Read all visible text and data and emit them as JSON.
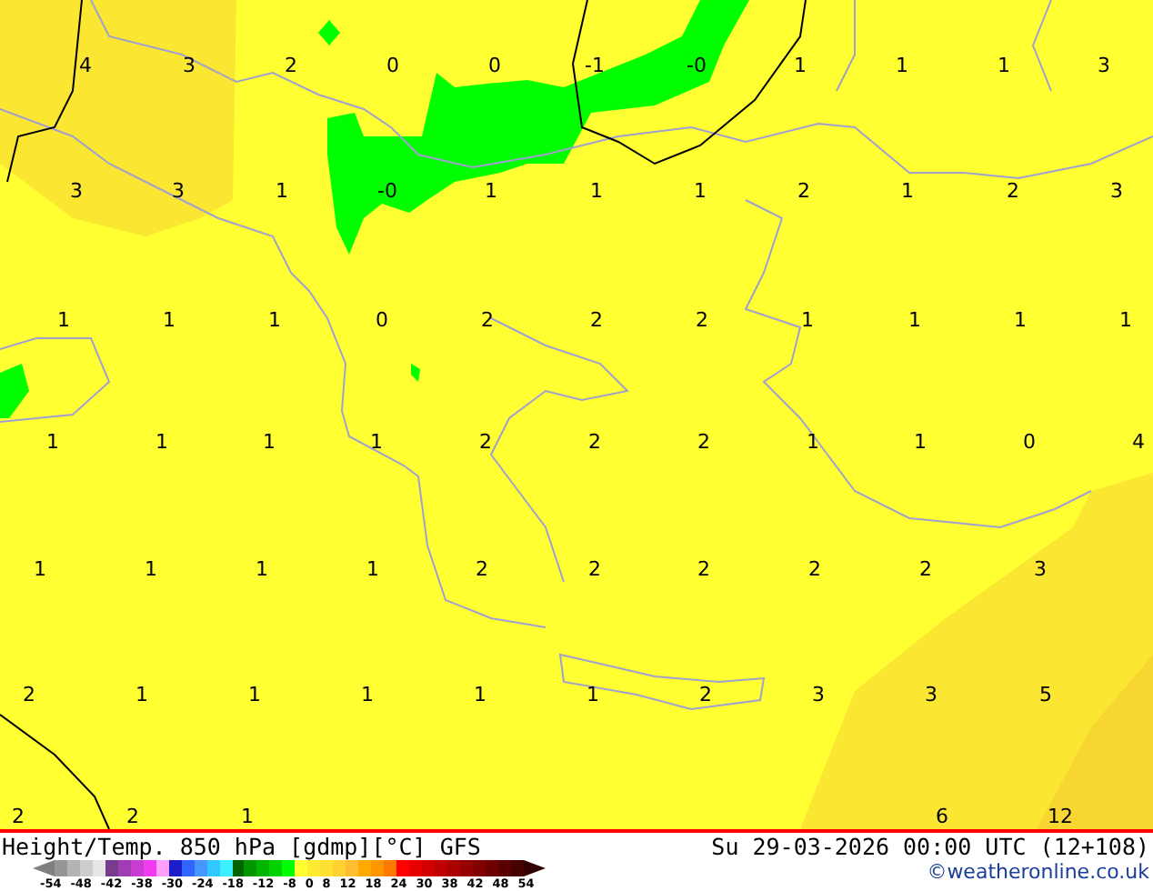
{
  "map": {
    "value_rows": [
      [
        "4",
        "3",
        "2",
        "0",
        "0",
        "-1",
        "-0",
        "1",
        "1",
        "1",
        "3"
      ],
      [
        "3",
        "3",
        "1",
        "-0",
        "1",
        "1",
        "1",
        "2",
        "1",
        "2",
        "3"
      ],
      [
        "1",
        "1",
        "1",
        "0",
        "2",
        "2",
        "2",
        "1",
        "1",
        "1",
        "1"
      ],
      [
        "1",
        "1",
        "1",
        "1",
        "2",
        "2",
        "2",
        "1",
        "1",
        "0",
        "4"
      ],
      [
        "1",
        "1",
        "1",
        "1",
        "2",
        "2",
        "2",
        "2",
        "2",
        "3"
      ],
      [
        "2",
        "1",
        "1",
        "1",
        "1",
        "1",
        "2",
        "3",
        "3",
        "5"
      ],
      [
        "2",
        "2",
        "1",
        "6",
        "12"
      ]
    ]
  },
  "footer": {
    "title": "Height/Temp. 850 hPa [gdmp][°C] GFS",
    "valid_time": "Su 29-03-2026 00:00 UTC (12+108)",
    "legend": {
      "colors": [
        {
          "color": "#969696"
        },
        {
          "color": "#b4b4b4"
        },
        {
          "color": "#cdcdcd"
        },
        {
          "color": "#e6e6e6"
        },
        {
          "color": "#783c8c"
        },
        {
          "color": "#a03cb4"
        },
        {
          "color": "#c83cd2"
        },
        {
          "color": "#f03cf0"
        },
        {
          "color": "#ffa0ff"
        },
        {
          "color": "#1e1ec8"
        },
        {
          "color": "#3264ff"
        },
        {
          "color": "#4696ff"
        },
        {
          "color": "#32c8ff"
        },
        {
          "color": "#3cf0ff"
        },
        {
          "color": "#006400"
        },
        {
          "color": "#009600"
        },
        {
          "color": "#00b400"
        },
        {
          "color": "#00d200"
        },
        {
          "color": "#00ff00"
        },
        {
          "color": "#ffff32"
        },
        {
          "color": "#ffeb32"
        },
        {
          "color": "#ffe132"
        },
        {
          "color": "#ffd232"
        },
        {
          "color": "#ffbe32"
        },
        {
          "color": "#ffaa00"
        },
        {
          "color": "#ff9600"
        },
        {
          "color": "#ff7800"
        },
        {
          "color": "#ff0000"
        },
        {
          "color": "#e60000"
        },
        {
          "color": "#d20000"
        },
        {
          "color": "#be0000"
        },
        {
          "color": "#aa0000"
        },
        {
          "color": "#960000"
        },
        {
          "color": "#820000"
        },
        {
          "color": "#6e0000"
        },
        {
          "color": "#5a0000"
        },
        {
          "color": "#460000"
        }
      ],
      "ticks": [
        "-54",
        "-48",
        "-42",
        "-38",
        "-30",
        "-24",
        "-18",
        "-12",
        "-8",
        "0",
        "8",
        "12",
        "18",
        "24",
        "30",
        "38",
        "42",
        "48",
        "54"
      ]
    },
    "copyright": "©weatheronline.co.uk"
  }
}
